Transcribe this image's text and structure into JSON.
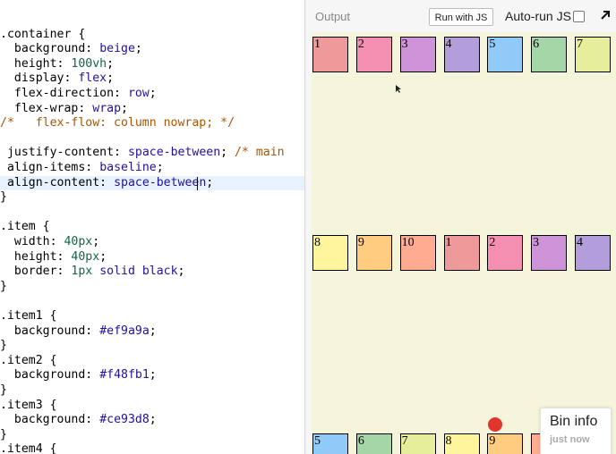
{
  "editor": {
    "lines": [
      [
        {
          "t": "sel",
          "v": ".container {"
        }
      ],
      [
        {
          "t": "plain",
          "v": "  "
        },
        {
          "t": "prop",
          "v": "background"
        },
        {
          "t": "plain",
          "v": ": "
        },
        {
          "t": "val",
          "v": "beige"
        },
        {
          "t": "plain",
          "v": ";"
        }
      ],
      [
        {
          "t": "plain",
          "v": "  "
        },
        {
          "t": "prop",
          "v": "height"
        },
        {
          "t": "plain",
          "v": ": "
        },
        {
          "t": "num",
          "v": "100vh"
        },
        {
          "t": "plain",
          "v": ";"
        }
      ],
      [
        {
          "t": "plain",
          "v": "  "
        },
        {
          "t": "prop",
          "v": "display"
        },
        {
          "t": "plain",
          "v": ": "
        },
        {
          "t": "val",
          "v": "flex"
        },
        {
          "t": "plain",
          "v": ";"
        }
      ],
      [
        {
          "t": "plain",
          "v": "  "
        },
        {
          "t": "prop",
          "v": "flex-direction"
        },
        {
          "t": "plain",
          "v": ": "
        },
        {
          "t": "val",
          "v": "row"
        },
        {
          "t": "plain",
          "v": ";"
        }
      ],
      [
        {
          "t": "plain",
          "v": "  "
        },
        {
          "t": "prop",
          "v": "flex-wrap"
        },
        {
          "t": "plain",
          "v": ": "
        },
        {
          "t": "val",
          "v": "wrap"
        },
        {
          "t": "plain",
          "v": ";"
        }
      ],
      [
        {
          "t": "com",
          "v": "/*   flex-flow: column nowrap; */"
        }
      ],
      [
        {
          "t": "plain",
          "v": ""
        }
      ],
      [
        {
          "t": "plain",
          "v": " "
        },
        {
          "t": "prop",
          "v": "justify-content"
        },
        {
          "t": "plain",
          "v": ": "
        },
        {
          "t": "val",
          "v": "space-between"
        },
        {
          "t": "plain",
          "v": "; "
        },
        {
          "t": "com",
          "v": "/* main"
        }
      ],
      [
        {
          "t": "plain",
          "v": " "
        },
        {
          "t": "prop",
          "v": "align-items"
        },
        {
          "t": "plain",
          "v": ": "
        },
        {
          "t": "val",
          "v": "baseline"
        },
        {
          "t": "plain",
          "v": ";"
        }
      ],
      [
        {
          "t": "plain",
          "v": " "
        },
        {
          "t": "prop",
          "v": "align-content"
        },
        {
          "t": "plain",
          "v": ": "
        },
        {
          "t": "val",
          "v": "space-between"
        },
        {
          "t": "plain",
          "v": ";"
        }
      ],
      [
        {
          "t": "plain",
          "v": "}"
        }
      ],
      [
        {
          "t": "plain",
          "v": ""
        }
      ],
      [
        {
          "t": "sel",
          "v": ".item {"
        }
      ],
      [
        {
          "t": "plain",
          "v": "  "
        },
        {
          "t": "prop",
          "v": "width"
        },
        {
          "t": "plain",
          "v": ": "
        },
        {
          "t": "num",
          "v": "40px"
        },
        {
          "t": "plain",
          "v": ";"
        }
      ],
      [
        {
          "t": "plain",
          "v": "  "
        },
        {
          "t": "prop",
          "v": "height"
        },
        {
          "t": "plain",
          "v": ": "
        },
        {
          "t": "num",
          "v": "40px"
        },
        {
          "t": "plain",
          "v": ";"
        }
      ],
      [
        {
          "t": "plain",
          "v": "  "
        },
        {
          "t": "prop",
          "v": "border"
        },
        {
          "t": "plain",
          "v": ": "
        },
        {
          "t": "num",
          "v": "1px"
        },
        {
          "t": "plain",
          "v": " "
        },
        {
          "t": "val",
          "v": "solid black"
        },
        {
          "t": "plain",
          "v": ";"
        }
      ],
      [
        {
          "t": "plain",
          "v": "}"
        }
      ],
      [
        {
          "t": "plain",
          "v": ""
        }
      ],
      [
        {
          "t": "sel",
          "v": ".item1 {"
        }
      ],
      [
        {
          "t": "plain",
          "v": "  "
        },
        {
          "t": "prop",
          "v": "background"
        },
        {
          "t": "plain",
          "v": ": "
        },
        {
          "t": "val",
          "v": "#ef9a9a"
        },
        {
          "t": "plain",
          "v": ";"
        }
      ],
      [
        {
          "t": "plain",
          "v": "}"
        }
      ],
      [
        {
          "t": "sel",
          "v": ".item2 {"
        }
      ],
      [
        {
          "t": "plain",
          "v": "  "
        },
        {
          "t": "prop",
          "v": "background"
        },
        {
          "t": "plain",
          "v": ": "
        },
        {
          "t": "val",
          "v": "#f48fb1"
        },
        {
          "t": "plain",
          "v": ";"
        }
      ],
      [
        {
          "t": "plain",
          "v": "}"
        }
      ],
      [
        {
          "t": "sel",
          "v": ".item3 {"
        }
      ],
      [
        {
          "t": "plain",
          "v": "  "
        },
        {
          "t": "prop",
          "v": "background"
        },
        {
          "t": "plain",
          "v": ": "
        },
        {
          "t": "val",
          "v": "#ce93d8"
        },
        {
          "t": "plain",
          "v": ";"
        }
      ],
      [
        {
          "t": "plain",
          "v": "}"
        }
      ],
      [
        {
          "t": "sel",
          "v": ".item4 {"
        }
      ]
    ],
    "active_line": 10
  },
  "output": {
    "label": "Output",
    "run_button": "Run with JS",
    "autorun_label": "Auto-run JS",
    "autorun_checked": false,
    "expand_icon": "expand-arrow-icon",
    "canvas_color": "#f5f5dc",
    "rows": [
      [
        {
          "label": "1",
          "color": "#ef9a9a"
        },
        {
          "label": "2",
          "color": "#f48fb1"
        },
        {
          "label": "3",
          "color": "#ce93d8"
        },
        {
          "label": "4",
          "color": "#b39ddb"
        },
        {
          "label": "5",
          "color": "#90caf9"
        },
        {
          "label": "6",
          "color": "#a5d6a7"
        },
        {
          "label": "7",
          "color": "#e6ee9c"
        }
      ],
      [
        {
          "label": "8",
          "color": "#fff59d"
        },
        {
          "label": "9",
          "color": "#ffcc80"
        },
        {
          "label": "10",
          "color": "#ffab91"
        },
        {
          "label": "1",
          "color": "#ef9a9a"
        },
        {
          "label": "2",
          "color": "#f48fb1"
        },
        {
          "label": "3",
          "color": "#ce93d8"
        },
        {
          "label": "4",
          "color": "#b39ddb"
        }
      ],
      [
        {
          "label": "5",
          "color": "#90caf9"
        },
        {
          "label": "6",
          "color": "#a5d6a7"
        },
        {
          "label": "7",
          "color": "#e6ee9c"
        },
        {
          "label": "8",
          "color": "#fff59d"
        },
        {
          "label": "9",
          "color": "#ffcc80"
        },
        {
          "label": "",
          "color": "#ffab91"
        }
      ]
    ]
  },
  "bin_info": {
    "title": "Bin info",
    "subtitle": "just now"
  }
}
